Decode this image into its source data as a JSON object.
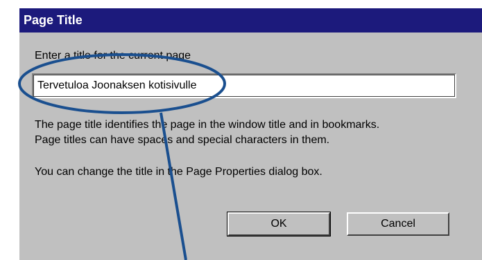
{
  "dialog": {
    "title": "Page Title",
    "prompt": "Enter a title for the current page",
    "input_value": "Tervetuloa Joonaksen kotisivulle",
    "description_line1": "The page title identifies the page in the window title and in bookmarks.",
    "description_line2": "Page titles can have spaces and special characters in them.",
    "hint": "You can change the title in the Page Properties dialog box.",
    "ok_label": "OK",
    "cancel_label": "Cancel"
  },
  "colors": {
    "titlebar": "#1c1a7c",
    "dialog_background": "#c0c0c0",
    "annotation": "#1a4f8f"
  }
}
